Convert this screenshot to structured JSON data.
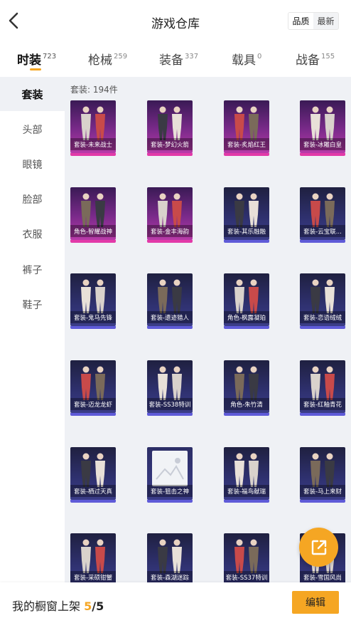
{
  "header": {
    "title": "游戏仓库",
    "sort_toggle": [
      "品质",
      "最新"
    ],
    "sort_selected": "品质"
  },
  "tabs": [
    {
      "label": "时装",
      "count": "723",
      "active": true
    },
    {
      "label": "枪械",
      "count": "259",
      "active": false
    },
    {
      "label": "装备",
      "count": "337",
      "active": false
    },
    {
      "label": "载具",
      "count": "0",
      "active": false
    },
    {
      "label": "战备",
      "count": "155",
      "active": false
    }
  ],
  "sidebar": {
    "items": [
      {
        "label": "套装",
        "active": true
      },
      {
        "label": "头部",
        "active": false
      },
      {
        "label": "眼镜",
        "active": false
      },
      {
        "label": "脸部",
        "active": false
      },
      {
        "label": "衣服",
        "active": false
      },
      {
        "label": "裤子",
        "active": false
      },
      {
        "label": "鞋子",
        "active": false
      }
    ]
  },
  "content": {
    "count_text": "套装: 194件",
    "items": [
      {
        "label": "套装-未来战士",
        "rarity": "pink"
      },
      {
        "label": "套装-梦幻火箭",
        "rarity": "pink"
      },
      {
        "label": "套装-炙焰红王",
        "rarity": "pink"
      },
      {
        "label": "套装-冰雕白皇",
        "rarity": "pink"
      },
      {
        "label": "角色-智耀战神",
        "rarity": "pink"
      },
      {
        "label": "套装-金丰海韵",
        "rarity": "pink"
      },
      {
        "label": "套装-其乐融融",
        "rarity": "blue"
      },
      {
        "label": "套装-云宝联...",
        "rarity": "blue"
      },
      {
        "label": "套装-鬼马先锋",
        "rarity": "blue"
      },
      {
        "label": "套装-遗迹猎人",
        "rarity": "blue"
      },
      {
        "label": "角色-枫露凝珀",
        "rarity": "blue"
      },
      {
        "label": "套装-恋语绒绒",
        "rarity": "blue"
      },
      {
        "label": "套装-迈龙龙虾",
        "rarity": "blue"
      },
      {
        "label": "套装-SS38特训",
        "rarity": "blue"
      },
      {
        "label": "角色-朱竹清",
        "rarity": "blue"
      },
      {
        "label": "套装-红釉青花",
        "rarity": "blue"
      },
      {
        "label": "套装-栖过天真",
        "rarity": "blue"
      },
      {
        "label": "套装-狙击之神",
        "rarity": "blue",
        "placeholder": true
      },
      {
        "label": "套装-福鸟献瑞",
        "rarity": "blue"
      },
      {
        "label": "套装-马上来财",
        "rarity": "blue"
      },
      {
        "label": "套装-采硕钳蟹",
        "rarity": "blue"
      },
      {
        "label": "套装-森湖迷踪",
        "rarity": "blue"
      },
      {
        "label": "套装-SS37特训",
        "rarity": "blue"
      },
      {
        "label": "套装-雪国风尚",
        "rarity": "blue"
      }
    ]
  },
  "footer": {
    "text": "我的橱窗上架",
    "shown": "5",
    "total": "/5",
    "edit_label": "编辑"
  },
  "icons": {
    "back": "chevron-left-icon",
    "fab": "external-link-icon"
  },
  "colors": {
    "accent": "#f5a623",
    "rarity_pink": "#e23aa8",
    "rarity_blue": "#5f5bd8",
    "panel_bg": "#eff1f5"
  }
}
